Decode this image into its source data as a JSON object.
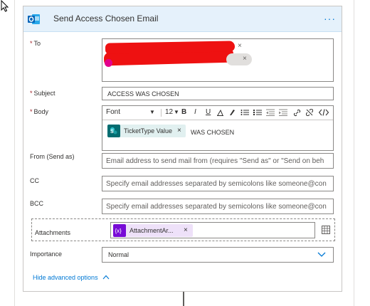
{
  "card": {
    "title": "Send Access Chosen Email",
    "more": "···"
  },
  "fields": {
    "to_label": "To",
    "subject_label": "Subject",
    "subject_value": "ACCESS WAS CHOSEN",
    "body_label": "Body",
    "from_label": "From (Send as)",
    "from_placeholder": "Email address to send mail from (requires \"Send as\" or \"Send on beh",
    "cc_label": "CC",
    "cc_placeholder": "Specify email addresses separated by semicolons like someone@con",
    "bcc_label": "BCC",
    "bcc_placeholder": "Specify email addresses separated by semicolons like someone@con",
    "attachments_label": "Attachments",
    "importance_label": "Importance",
    "importance_value": "Normal",
    "required_mark": "*"
  },
  "toolbar": {
    "font": "Font",
    "font_size": "12",
    "bold": "B",
    "italic": "I",
    "underline": "U",
    "dropdown_arrow": "▼"
  },
  "tokens": {
    "body_token": "TicketType Value",
    "body_after": "WAS CHOSEN",
    "attachment_token": "AttachmentAr...",
    "close": "×"
  },
  "footer": {
    "advanced_label": "Hide advanced options"
  },
  "colors": {
    "accent": "#0078d4",
    "header_bg": "#e5f1fb",
    "redaction": "#ee1111",
    "sharepoint_token": "#036c70",
    "variable_token": "#770bd6"
  }
}
